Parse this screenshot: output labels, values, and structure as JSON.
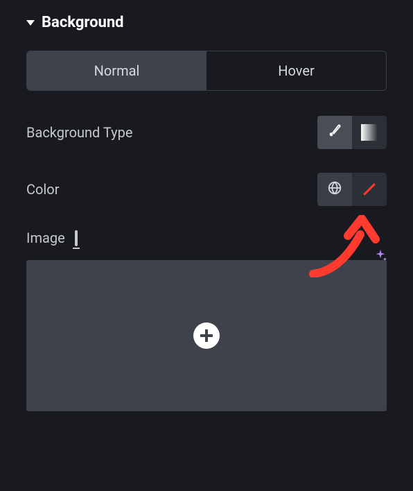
{
  "section": {
    "title": "Background"
  },
  "tabs": {
    "normal": "Normal",
    "hover": "Hover"
  },
  "controls": {
    "backgroundType": {
      "label": "Background Type",
      "options": {
        "classic": "classic",
        "gradient": "gradient"
      },
      "selected": "classic"
    },
    "color": {
      "label": "Color",
      "value": "transparent"
    },
    "image": {
      "label": "Image"
    }
  }
}
